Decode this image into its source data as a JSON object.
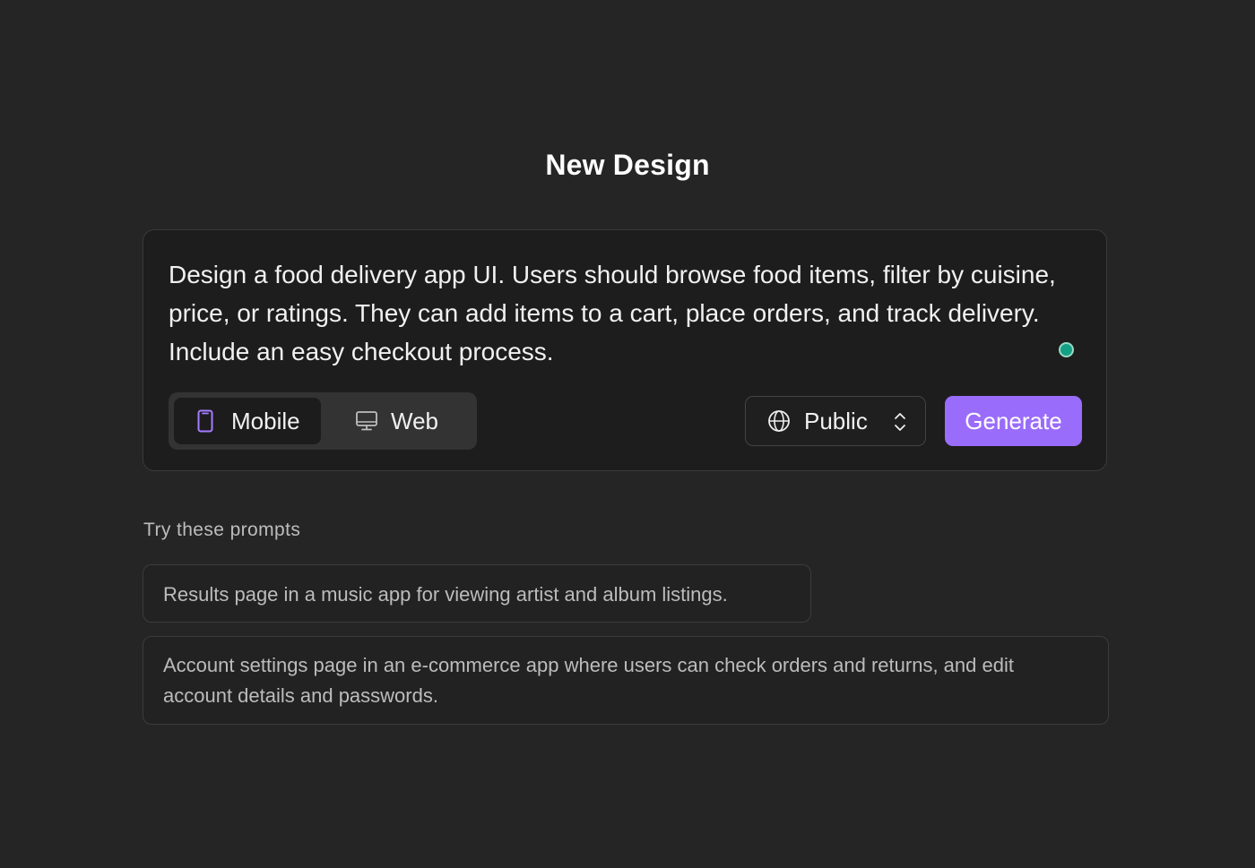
{
  "header": {
    "title": "New Design"
  },
  "prompt": {
    "text": "Design a food delivery app UI. Users should browse food items, filter by cuisine, price, or ratings. They can add items to a cart, place orders, and track delivery. Include an easy checkout process.",
    "status_color": "#14a085"
  },
  "device_toggle": {
    "options": [
      {
        "label": "Mobile",
        "icon": "phone-icon",
        "selected": true
      },
      {
        "label": "Web",
        "icon": "monitor-icon",
        "selected": false
      }
    ]
  },
  "visibility": {
    "label": "Public",
    "icon": "globe-icon",
    "chevron": "chevron-up-down-icon"
  },
  "generate": {
    "label": "Generate",
    "color": "#9a6cfb"
  },
  "suggestions": {
    "heading": "Try these prompts",
    "items": [
      {
        "text": "Results page in a music app for viewing artist and album listings."
      },
      {
        "text": "Account settings page in an e-commerce app where users can check orders and returns, and edit account details and passwords."
      }
    ]
  },
  "theme": {
    "background": "#252525",
    "card": "#1d1d1d",
    "accent": "#9a6cfb"
  }
}
